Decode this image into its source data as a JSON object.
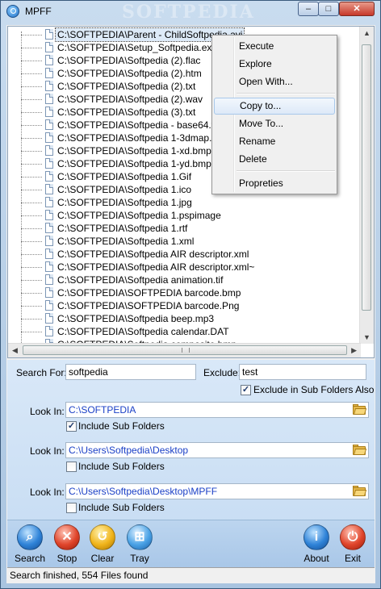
{
  "window": {
    "title": "MPFF",
    "watermark": "SOFTPEDIA",
    "min_glyph": "–",
    "max_glyph": "□",
    "close_glyph": "✕"
  },
  "tree": {
    "items": [
      "C:\\SOFTPEDIA\\Parent - ChildSoftpedia.avi",
      "C:\\SOFTPEDIA\\Setup_Softpedia.exe",
      "C:\\SOFTPEDIA\\Softpedia (2).flac",
      "C:\\SOFTPEDIA\\Softpedia (2).htm",
      "C:\\SOFTPEDIA\\Softpedia (2).txt",
      "C:\\SOFTPEDIA\\Softpedia (2).wav",
      "C:\\SOFTPEDIA\\Softpedia (3).txt",
      "C:\\SOFTPEDIA\\Softpedia - base64.txt",
      "C:\\SOFTPEDIA\\Softpedia 1-3dmap.bmp",
      "C:\\SOFTPEDIA\\Softpedia 1-xd.bmp",
      "C:\\SOFTPEDIA\\Softpedia 1-yd.bmp",
      "C:\\SOFTPEDIA\\Softpedia 1.Gif",
      "C:\\SOFTPEDIA\\Softpedia 1.ico",
      "C:\\SOFTPEDIA\\Softpedia 1.jpg",
      "C:\\SOFTPEDIA\\Softpedia 1.pspimage",
      "C:\\SOFTPEDIA\\Softpedia 1.rtf",
      "C:\\SOFTPEDIA\\Softpedia 1.xml",
      "C:\\SOFTPEDIA\\Softpedia AIR descriptor.xml",
      "C:\\SOFTPEDIA\\Softpedia AIR descriptor.xml~",
      "C:\\SOFTPEDIA\\Softpedia animation.tif",
      "C:\\SOFTPEDIA\\SOFTPEDIA barcode.bmp",
      "C:\\SOFTPEDIA\\SOFTPEDIA barcode.Png",
      "C:\\SOFTPEDIA\\Softpedia beep.mp3",
      "C:\\SOFTPEDIA\\Softpedia calendar.DAT",
      "C:\\SOFTPEDIA\\Softpedia composite.bmp"
    ],
    "selected_index": 0
  },
  "context_menu": {
    "items": [
      "Execute",
      "Explore",
      "Open With...",
      "Copy to...",
      "Move To...",
      "Rename",
      "Delete",
      "Propreties"
    ],
    "highlighted_index": 3
  },
  "search": {
    "search_for_label": "Search For:",
    "search_for_value": "softpedia",
    "exclude_label": "Exclude:",
    "exclude_value": "test",
    "exclude_sub_label": "Exclude in Sub Folders Also",
    "exclude_sub_checked": true
  },
  "look_in": [
    {
      "label": "Look In:",
      "path": "C:\\SOFTPEDIA",
      "include_label": "Include Sub Folders",
      "include_checked": true
    },
    {
      "label": "Look In:",
      "path": "C:\\Users\\Softpedia\\Desktop",
      "include_label": "Include Sub Folders",
      "include_checked": false
    },
    {
      "label": "Look In:",
      "path": "C:\\Users\\Softpedia\\Desktop\\MPFF",
      "include_label": "Include Sub Folders",
      "include_checked": false
    }
  ],
  "toolbar": {
    "search": "Search",
    "stop": "Stop",
    "clear": "Clear",
    "tray": "Tray",
    "about": "About",
    "exit": "Exit"
  },
  "status": {
    "text": "Search finished, 554 Files found"
  }
}
